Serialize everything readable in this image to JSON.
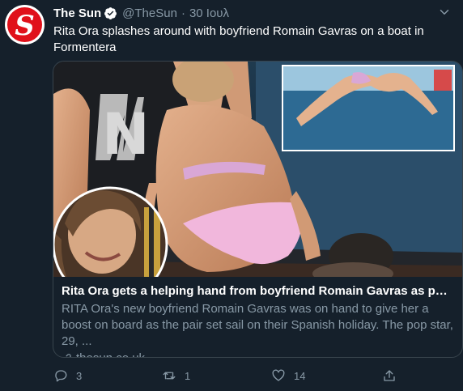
{
  "tweet": {
    "author_name": "The Sun",
    "handle": "@TheSun",
    "separator": "·",
    "date": "30 Ιουλ",
    "text": "Rita Ora splashes around with boyfriend Romain Gavras on a boat in Formentera",
    "avatar_letter": "S"
  },
  "card": {
    "title": "Rita Ora gets a helping hand from boyfriend Romain Gavras as pair take...",
    "description": "RITA Ora's new boyfriend Romain Gavras was on hand to give her a boost on board as the pair set sail on their Spanish holiday. The pop star, 29, ...",
    "domain": "thesun.co.uk",
    "boat_letter": "N"
  },
  "actions": {
    "replies": "3",
    "retweets": "1",
    "likes": "14"
  },
  "colors": {
    "background": "#15202b",
    "secondary_text": "#8899a6",
    "border": "#38444d",
    "brand_red": "#e0101a",
    "verified_blue": "#1da1f2"
  },
  "icons": [
    "verified-icon",
    "caret-down-icon",
    "link-icon",
    "reply-icon",
    "retweet-icon",
    "like-icon",
    "share-icon"
  ]
}
